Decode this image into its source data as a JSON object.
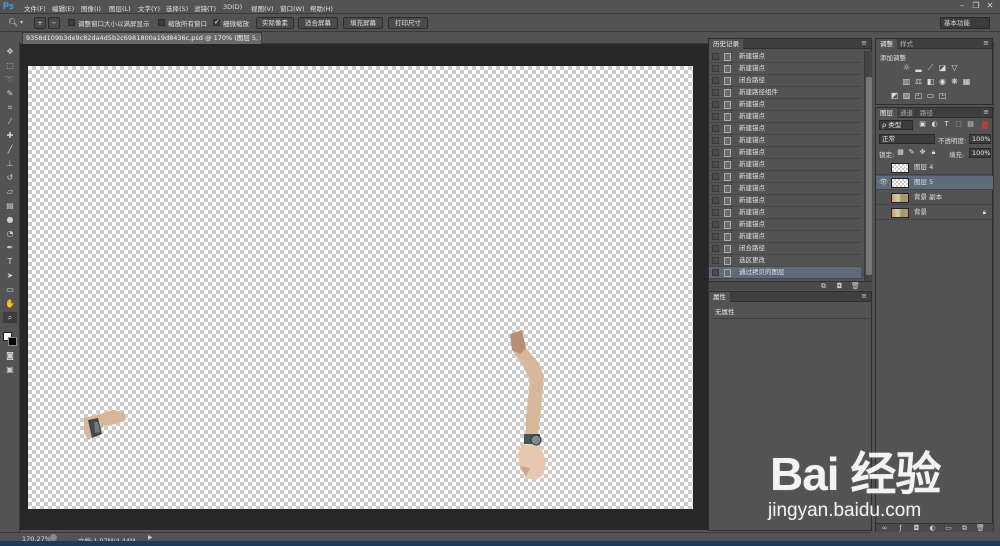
{
  "app": {
    "logo": "Ps"
  },
  "menu": [
    "文件(F)",
    "编辑(E)",
    "图像(I)",
    "图层(L)",
    "文字(Y)",
    "选择(S)",
    "滤镜(T)",
    "3D(D)",
    "视图(V)",
    "窗口(W)",
    "帮助(H)"
  ],
  "window_controls": {
    "minimize": "–",
    "restore": "❐",
    "close": "✕"
  },
  "options": {
    "resize_windows_label": "调整窗口大小以满屏显示",
    "zoom_all_label": "缩放所有窗口",
    "scrubby_zoom_label": "细微缩放",
    "actual_pixels": "实际像素",
    "fit_screen": "适合屏幕",
    "fill_screen": "填充屏幕",
    "print_size": "打印尺寸",
    "workspace": "基本功能"
  },
  "document": {
    "tab_title": "9358d109b3de9c82da4d5b2c6981800a19d8436c.psd @ 170% (图层 5, RGB/8#) *",
    "close": "×"
  },
  "tools": [
    "move-tool",
    "marquee-tool",
    "lasso-tool",
    "quick-select-tool",
    "crop-tool",
    "eyedropper-tool",
    "healing-tool",
    "brush-tool",
    "clone-stamp-tool",
    "history-brush-tool",
    "eraser-tool",
    "gradient-tool",
    "blur-tool",
    "dodge-tool",
    "pen-tool",
    "type-tool",
    "path-select-tool",
    "rectangle-tool",
    "hand-tool",
    "zoom-tool"
  ],
  "history": {
    "tab": "历史记录",
    "items": [
      "新建锚点",
      "新建锚点",
      "闭合路径",
      "新建路径组件",
      "新建锚点",
      "新建锚点",
      "新建锚点",
      "新建锚点",
      "新建锚点",
      "新建锚点",
      "新建锚点",
      "新建锚点",
      "新建锚点",
      "新建锚点",
      "新建锚点",
      "新建锚点",
      "闭合路径",
      "选区更改",
      "通过拷贝的图层"
    ],
    "selected_index": 18
  },
  "properties": {
    "tab": "属性",
    "text": "无属性"
  },
  "adjustments": {
    "tabs": [
      "调整",
      "样式"
    ],
    "title": "添加调整"
  },
  "layers_panel": {
    "tabs": [
      "图层",
      "通道",
      "路径"
    ],
    "filter": "ρ 类型",
    "blend_mode": "正常",
    "opacity_label": "不透明度:",
    "opacity_value": "100%",
    "lock_label": "锁定:",
    "fill_label": "填充:",
    "fill_value": "100%",
    "layers": [
      {
        "name": "图层 4",
        "visible": false,
        "selected": false,
        "thumb": "transparent"
      },
      {
        "name": "图层 5",
        "visible": true,
        "selected": true,
        "thumb": "transparent"
      },
      {
        "name": "背景 副本",
        "visible": false,
        "selected": false,
        "thumb": "photo"
      },
      {
        "name": "背景",
        "visible": false,
        "selected": false,
        "thumb": "photo",
        "locked": true
      }
    ]
  },
  "status": {
    "zoom": "170.27%",
    "doc_size": "文档:1.07M/4.44M"
  },
  "watermark": {
    "logo": "Bai 经验",
    "url": "jingyan.baidu.com"
  }
}
